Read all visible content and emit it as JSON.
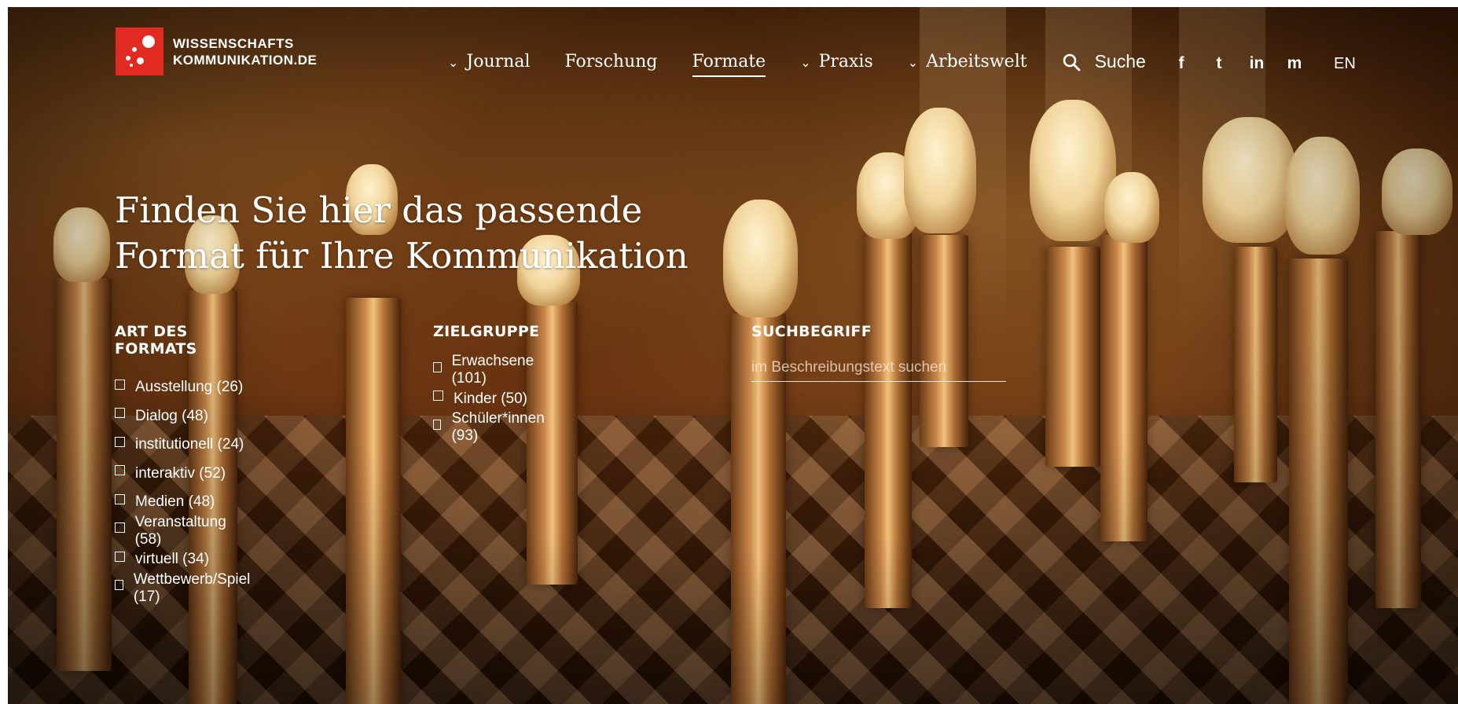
{
  "header": {
    "logo_line1": "WISSENSCHAFTS",
    "logo_line2": "KOMMUNIKATION.DE",
    "brand_color": "#e32a22",
    "nav": [
      {
        "label": "Journal",
        "has_dropdown": true
      },
      {
        "label": "Forschung",
        "has_dropdown": false
      },
      {
        "label": "Formate",
        "has_dropdown": false,
        "active": true
      },
      {
        "label": "Praxis",
        "has_dropdown": true
      },
      {
        "label": "Arbeitswelt",
        "has_dropdown": true
      }
    ],
    "search_label": "Suche",
    "social_icons": [
      "facebook-icon",
      "twitter-icon",
      "linkedin-icon",
      "mastodon-icon"
    ],
    "social_glyphs": [
      "f",
      "t",
      "in",
      "m"
    ],
    "language": "EN"
  },
  "hero": {
    "title_line1": "Finden Sie hier das passende",
    "title_line2": "Format für Ihre Kommunikation"
  },
  "filters": {
    "format": {
      "heading": "ART DES FORMATS",
      "options": [
        "Ausstellung (26)",
        "Dialog (48)",
        "institutionell (24)",
        "interaktiv (52)",
        "Medien (48)",
        "Veranstaltung (58)",
        "virtuell (34)",
        "Wettbewerb/Spiel (17)"
      ]
    },
    "audience": {
      "heading": "ZIELGRUPPE",
      "options": [
        "Erwachsene (101)",
        "Kinder (50)",
        "Schüler*innen (93)"
      ]
    },
    "search": {
      "heading": "SUCHBEGRIFF",
      "placeholder": "im Beschreibungstext suchen"
    }
  }
}
